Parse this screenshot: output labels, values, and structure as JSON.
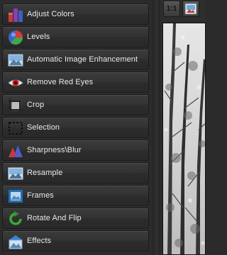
{
  "tools": [
    {
      "label": "Adjust Colors",
      "icon": "adjust-colors-icon"
    },
    {
      "label": "Levels",
      "icon": "levels-icon"
    },
    {
      "label": "Automatic Image Enhancement",
      "icon": "auto-enhance-icon"
    },
    {
      "label": "Remove Red Eyes",
      "icon": "red-eye-icon"
    },
    {
      "label": "Crop",
      "icon": "crop-icon"
    },
    {
      "label": "Selection",
      "icon": "selection-icon"
    },
    {
      "label": "Sharpness\\Blur",
      "icon": "sharpness-icon"
    },
    {
      "label": "Resample",
      "icon": "resample-icon"
    },
    {
      "label": "Frames",
      "icon": "frames-icon"
    },
    {
      "label": "Rotate And Flip",
      "icon": "rotate-flip-icon"
    },
    {
      "label": "Effects",
      "icon": "effects-icon"
    }
  ],
  "toolbar": {
    "actual_size_label": "1:1",
    "fit_icon": "fit-to-window-icon"
  }
}
